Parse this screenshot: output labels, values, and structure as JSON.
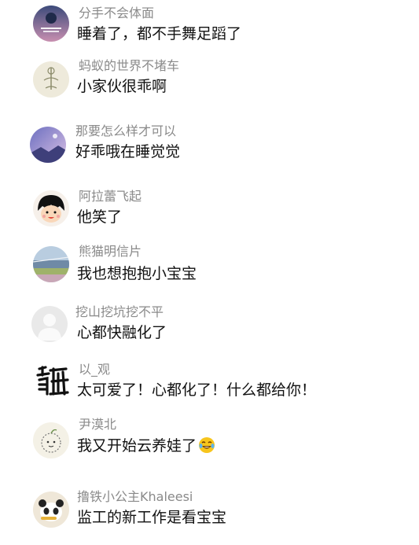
{
  "comments": [
    {
      "username": "分手不会体面",
      "text": "睡着了，都不手舞足蹈了",
      "avatar": "night-poster-avatar"
    },
    {
      "username": "蚂蚁的世界不堵车",
      "text": "小家伙很乖啊",
      "avatar": "sketch-avatar"
    },
    {
      "username": "那要怎么样才可以",
      "text": "好乖哦在睡觉觉",
      "avatar": "purple-sky-avatar"
    },
    {
      "username": "阿拉蕾飞起",
      "text": "他笑了",
      "avatar": "cartoon-girl-avatar"
    },
    {
      "username": "熊猫明信片",
      "text": "我也想抱抱小宝宝",
      "avatar": "landscape-avatar"
    },
    {
      "username": "挖山挖坑挖不平",
      "text": "心都快融化了",
      "avatar": "default-user-avatar"
    },
    {
      "username": "以_观",
      "text": "太可爱了！心都化了！什么都给你！",
      "avatar": "calligraphy-avatar"
    },
    {
      "username": "尹漠北",
      "text": "我又开始云养娃了",
      "avatar": "doodle-avatar",
      "emoji": "laughing-tears-emoji"
    },
    {
      "username": "撸铁小公主Khaleesi",
      "text": "监工的新工作是看宝宝",
      "avatar": "panda-avatar"
    }
  ]
}
